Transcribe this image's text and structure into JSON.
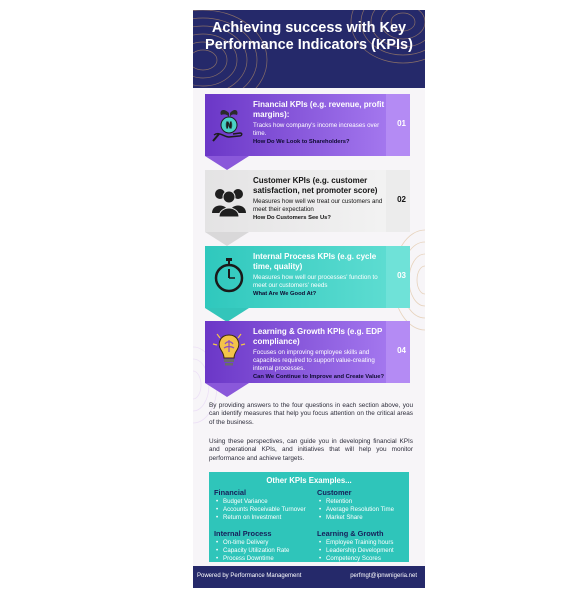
{
  "header": {
    "title": "Achieving success with Key Performance Indicators (KPIs)"
  },
  "kpis": [
    {
      "number": "01",
      "heading": "Financial KPIs (e.g. revenue, profit margins):",
      "description": "Tracks how company's income increases over time.",
      "question": "How Do We Look to Shareholders?",
      "icon": "money-plant-icon"
    },
    {
      "number": "02",
      "heading": "Customer KPIs (e.g. customer satisfaction, net promoter score)",
      "description": "Measures how well we treat our customers and meet their expectation",
      "question": "How Do Customers See Us?",
      "icon": "customers-group-icon"
    },
    {
      "number": "03",
      "heading": "Internal Process KPIs (e.g. cycle time, quality)",
      "description": "Measures how well our processes' function to meet our customers' needs",
      "question": "What Are We Good At?",
      "icon": "stopwatch-icon"
    },
    {
      "number": "04",
      "heading": "Learning & Growth KPIs (e.g. EDP compliance)",
      "description": "Focuses on improving employee skills and capacities required to support value-creating internal processes.",
      "question": "Can We Continue to Improve and Create Value?",
      "icon": "lightbulb-brain-icon"
    }
  ],
  "paragraphs": [
    "By providing answers to the four questions in each section above, you can identify measures that help you focus attention on the critical areas of the business.",
    "Using these perspectives, can guide you in developing financial KPIs and operational KPIs, and initiatives that will help you monitor performance and achieve targets."
  ],
  "other": {
    "title": "Other KPIs Examples...",
    "groups": [
      {
        "heading": "Financial",
        "items": [
          "Budget Variance",
          "Accounts Receivable Turnover",
          "Return on Investment"
        ]
      },
      {
        "heading": "Customer",
        "items": [
          "Retention",
          "Average Resolution Time",
          "Market Share"
        ]
      },
      {
        "heading": "Internal Process",
        "items": [
          "On-time Delivery",
          "Capacity Utilization Rate",
          "Process Downtime"
        ]
      },
      {
        "heading": "Learning & Growth",
        "items": [
          "Employee Training hours",
          "Leadership Development",
          "Competency Scores"
        ]
      }
    ]
  },
  "footer": {
    "left": "Powered by Performance Management",
    "right": "perfmgt@ipnwnigeria.net"
  },
  "colors": {
    "navy": "#25296a",
    "purple": "#7c4ad3",
    "teal": "#2fc5ba",
    "grey": "#e6e6e6"
  }
}
